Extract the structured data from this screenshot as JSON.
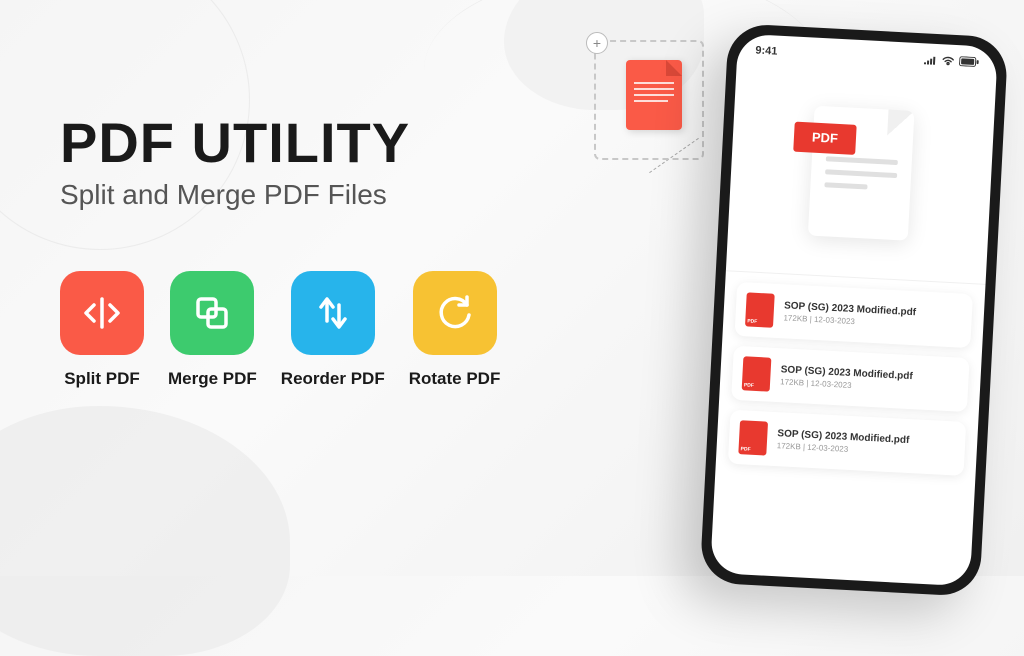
{
  "hero": {
    "title": "PDF UTILITY",
    "subtitle": "Split and Merge PDF Files"
  },
  "features": [
    {
      "label": "Split PDF",
      "color": "red"
    },
    {
      "label": "Merge PDF",
      "color": "green"
    },
    {
      "label": "Reorder PDF",
      "color": "blue"
    },
    {
      "label": "Rotate PDF",
      "color": "yellow"
    }
  ],
  "phone": {
    "statusbar": {
      "time": "9:41"
    },
    "hero_badge": "PDF",
    "files": [
      {
        "name": "SOP (SG) 2023 Modified.pdf",
        "meta": "172KB | 12-03-2023"
      },
      {
        "name": "SOP (SG) 2023 Modified.pdf",
        "meta": "172KB | 12-03-2023"
      },
      {
        "name": "SOP (SG) 2023 Modified.pdf",
        "meta": "172KB | 12-03-2023"
      }
    ]
  }
}
